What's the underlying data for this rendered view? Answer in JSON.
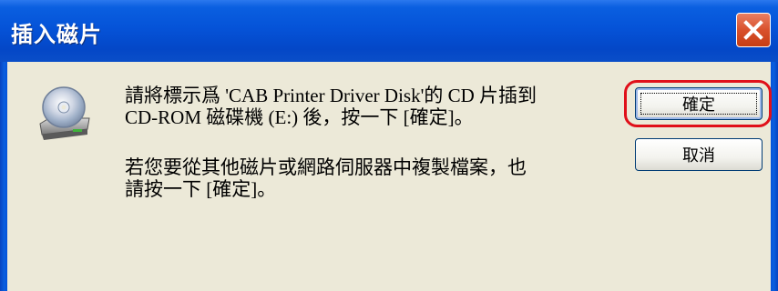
{
  "dialog": {
    "title": "插入磁片",
    "message_line1": "請將標示爲 'CAB Printer Driver Disk'的 CD 片插到",
    "message_line2": "CD-ROM 磁碟機 (E:) 後，按一下 [確定]。",
    "message_line3": "若您要從其他磁片或網路伺服器中複製檔案，也",
    "message_line4": "請按一下 [確定]。",
    "ok_label": "確定",
    "cancel_label": "取消",
    "icon": "cd-drive-icon",
    "close_icon": "close-icon"
  },
  "colors": {
    "titlebar": "#0553d8",
    "client_bg": "#ece9d8",
    "close_button": "#d9512c",
    "highlight": "#e0101a"
  }
}
